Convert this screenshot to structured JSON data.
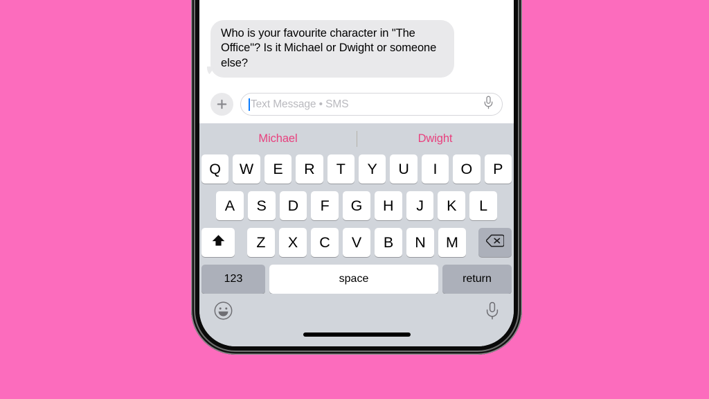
{
  "background": {
    "color": "#FC6CBD"
  },
  "device": {
    "name": "iphone-frame",
    "bezel_color": "#0a0a0a"
  },
  "conversation": {
    "messages": [
      {
        "sender": "incoming",
        "text": "Who is your favourite character in \"The Office\"? Is it Michael or Dwight or someone else?",
        "bubble_color": "#E9E9EB",
        "text_color": "#000000"
      }
    ]
  },
  "input_bar": {
    "plus_button_label": "+",
    "placeholder": "Text Message • SMS",
    "value": "",
    "caret_color": "#0A7CFF",
    "mic_icon": "microphone-icon"
  },
  "suggestions": {
    "bar_color": "#D1D5DB",
    "word_color": "#E8417E",
    "arrow_color": "#F2401A",
    "items": [
      {
        "label": "Michael",
        "arrow": "right"
      },
      {
        "label": "Dwight",
        "arrow": "left"
      }
    ]
  },
  "keyboard": {
    "background": "#D1D5DB",
    "key_color": "#FFFFFF",
    "modifier_key_color": "#ACB0BA",
    "rows": [
      [
        "Q",
        "W",
        "E",
        "R",
        "T",
        "Y",
        "U",
        "I",
        "O",
        "P"
      ],
      [
        "A",
        "S",
        "D",
        "F",
        "G",
        "H",
        "J",
        "K",
        "L"
      ],
      [
        "Z",
        "X",
        "C",
        "V",
        "B",
        "N",
        "M"
      ]
    ],
    "shift_key": {
      "name": "shift-key",
      "icon": "shift-arrow-icon",
      "state": "active"
    },
    "backspace_key": {
      "name": "backspace-key",
      "icon": "backspace-icon"
    },
    "numeric_key": {
      "label": "123"
    },
    "space_key": {
      "label": "space"
    },
    "return_key": {
      "label": "return"
    }
  },
  "bottom_bar": {
    "emoji_icon": "emoji-smiley-icon",
    "dictation_icon": "microphone-icon"
  }
}
